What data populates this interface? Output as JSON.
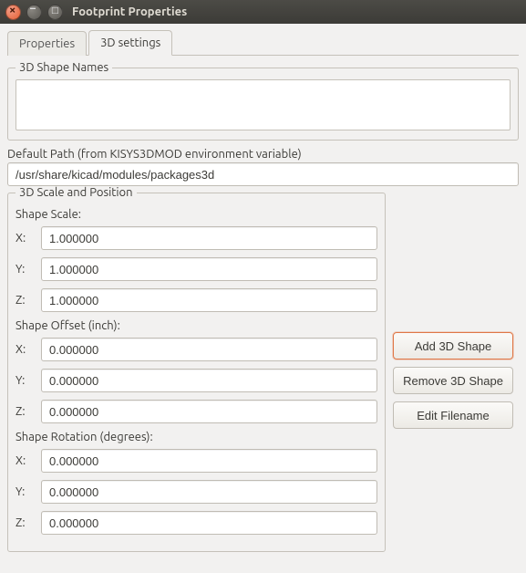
{
  "window": {
    "title": "Footprint Properties"
  },
  "tabs": {
    "properties": "Properties",
    "settings3d": "3D settings"
  },
  "shapes": {
    "legend": "3D Shape Names"
  },
  "default_path": {
    "label": "Default Path (from KISYS3DMOD environment variable)",
    "value": "/usr/share/kicad/modules/packages3d"
  },
  "scalepos": {
    "legend": "3D Scale and Position",
    "scale": {
      "label": "Shape Scale:",
      "x_label": "X:",
      "x": "1.000000",
      "y_label": "Y:",
      "y": "1.000000",
      "z_label": "Z:",
      "z": "1.000000"
    },
    "offset": {
      "label": "Shape Offset (inch):",
      "x_label": "X:",
      "x": "0.000000",
      "y_label": "Y:",
      "y": "0.000000",
      "z_label": "Z:",
      "z": "0.000000"
    },
    "rotation": {
      "label": "Shape Rotation (degrees):",
      "x_label": "X:",
      "x": "0.000000",
      "y_label": "Y:",
      "y": "0.000000",
      "z_label": "Z:",
      "z": "0.000000"
    }
  },
  "buttons": {
    "add": "Add 3D Shape",
    "remove": "Remove 3D Shape",
    "edit": "Edit Filename"
  }
}
